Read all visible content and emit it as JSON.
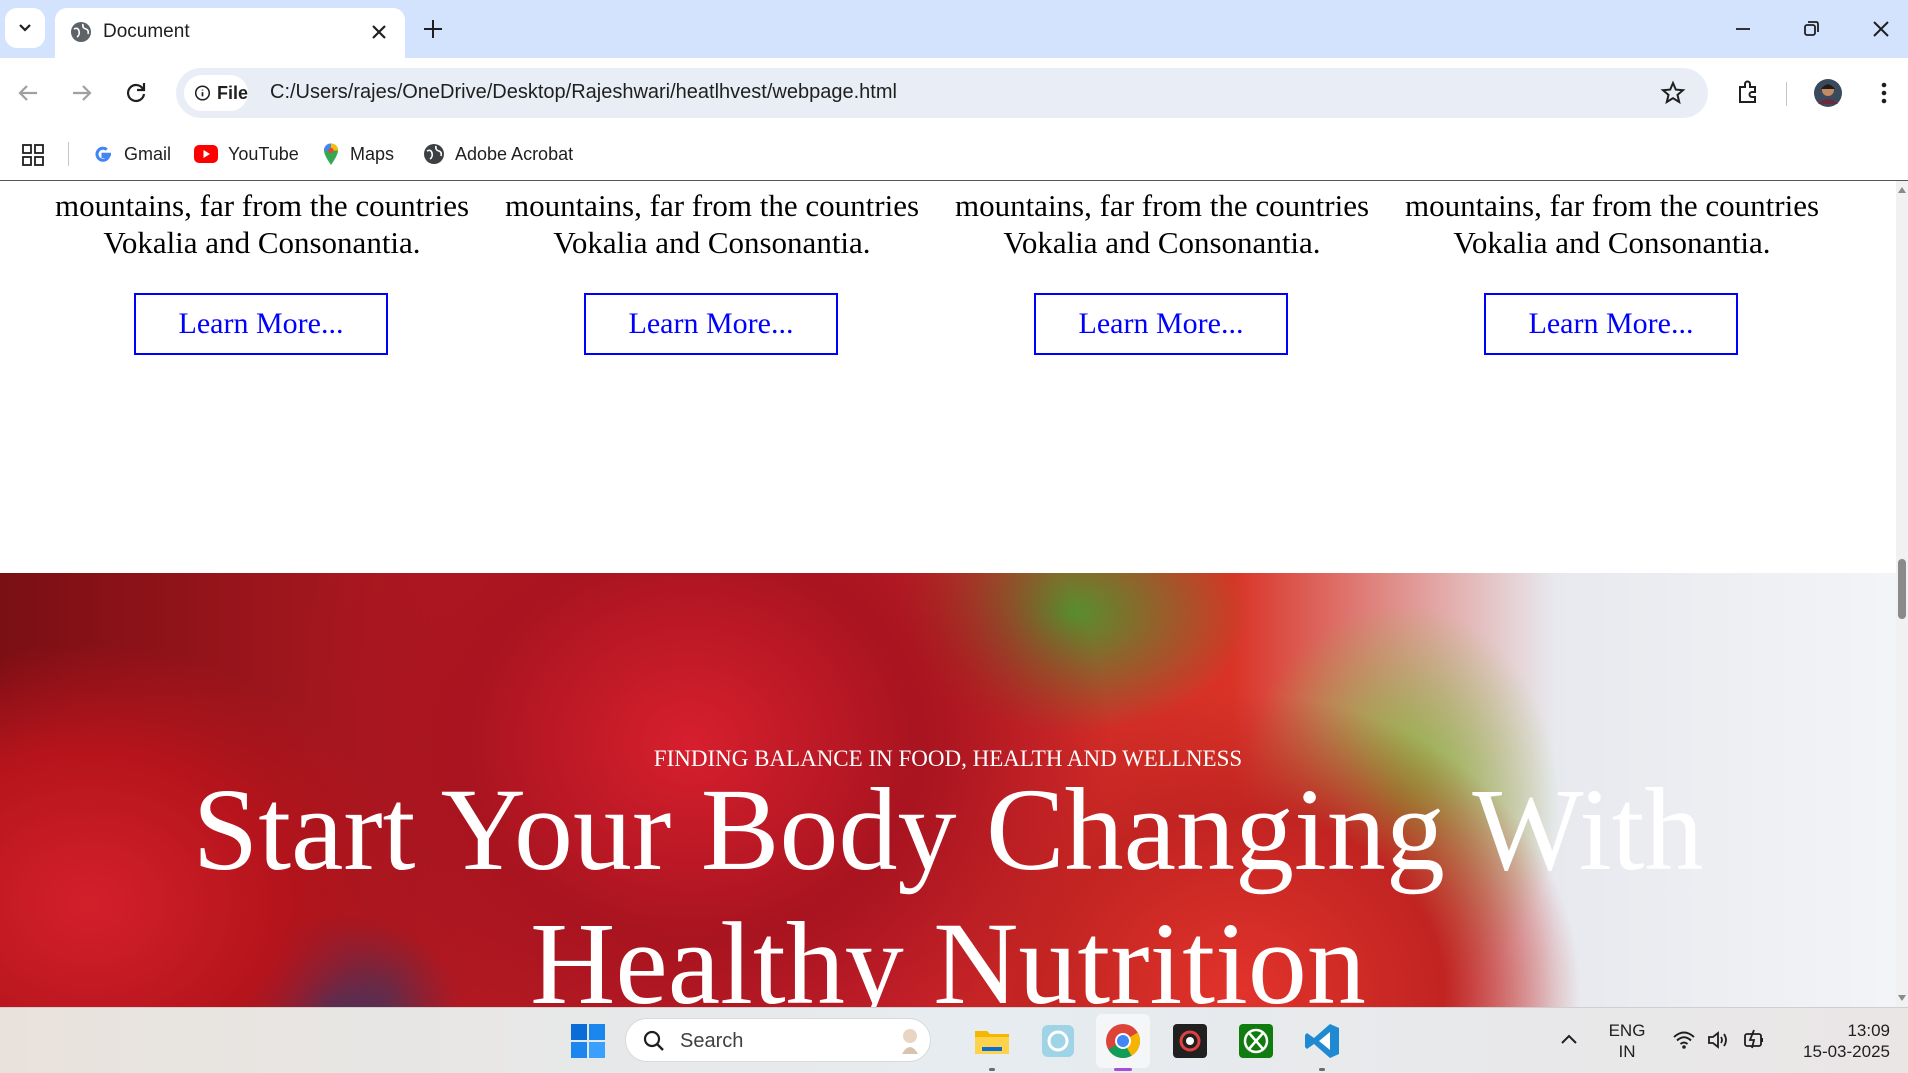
{
  "browser": {
    "tab_title": "Document",
    "site_chip_label": "File",
    "url": "C:/Users/rajes/OneDrive/Desktop/Rajeshwari/heatlhvest/webpage.html",
    "bookmarks": [
      {
        "label": "Gmail",
        "icon": "google-icon"
      },
      {
        "label": "YouTube",
        "icon": "youtube-icon"
      },
      {
        "label": "Maps",
        "icon": "maps-icon"
      },
      {
        "label": "Adobe Acrobat",
        "icon": "globe-icon"
      }
    ]
  },
  "page": {
    "cards": [
      {
        "text_line1": "mountains, far from the countries",
        "text_line2": "Vokalia and Consonantia.",
        "button": "Learn More..."
      },
      {
        "text_line1": "mountains, far from the countries",
        "text_line2": "Vokalia and Consonantia.",
        "button": "Learn More..."
      },
      {
        "text_line1": "mountains, far from the countries",
        "text_line2": "Vokalia and Consonantia.",
        "button": "Learn More..."
      },
      {
        "text_line1": "mountains, far from the countries",
        "text_line2": "Vokalia and Consonantia.",
        "button": "Learn More..."
      }
    ],
    "hero": {
      "subtitle": "FINDING BALANCE IN FOOD, HEALTH AND WELLNESS",
      "title_line1": "Start Your Body Changing With",
      "title_line2": "Healthy Nutrition"
    }
  },
  "taskbar": {
    "search_placeholder": "Search",
    "language_line1": "ENG",
    "language_line2": "IN",
    "time": "13:09",
    "date": "15-03-2025"
  },
  "colors": {
    "tabstrip": "#d3e3fd",
    "link_blue": "#0000ff"
  }
}
